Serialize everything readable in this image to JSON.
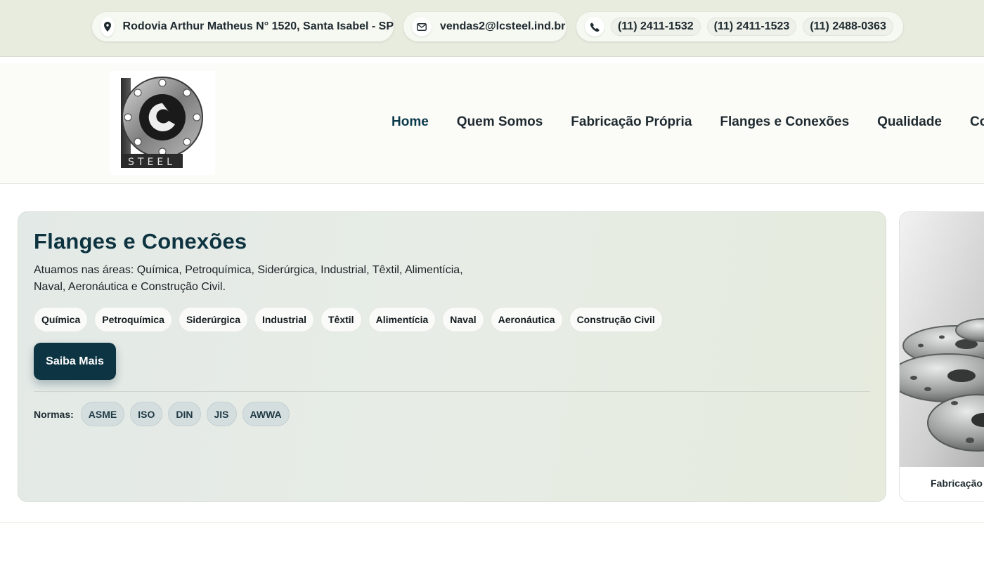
{
  "topbar": {
    "address": "Rodovia Arthur Matheus N° 1520, Santa Isabel - SP",
    "email": "vendas2@lcsteel.ind.br",
    "phones": [
      "(11) 2411-1532",
      "(11) 2411-1523",
      "(11) 2488-0363"
    ],
    "icons": {
      "address": "map-pin-icon",
      "email": "mail-icon",
      "phone": "phone-icon"
    }
  },
  "header": {
    "logo_text": "STEEL",
    "nav": [
      {
        "label": "Home",
        "active": true
      },
      {
        "label": "Quem Somos",
        "active": false
      },
      {
        "label": "Fabricação Própria",
        "active": false
      },
      {
        "label": "Flanges e Conexões",
        "active": false
      },
      {
        "label": "Qualidade",
        "active": false
      },
      {
        "label": "Contato",
        "active": false
      }
    ]
  },
  "hero": {
    "title": "Flanges e Conexões",
    "description": "Atuamos nas áreas: Química, Petroquímica, Siderúrgica, Industrial, Têxtil, Alimentícia, Naval, Aeronáutica e Construção Civil.",
    "tags": [
      "Química",
      "Petroquímica",
      "Siderúrgica",
      "Industrial",
      "Têxtil",
      "Alimentícia",
      "Naval",
      "Aeronáutica",
      "Construção Civil"
    ],
    "button_label": "Saiba Mais",
    "normas_label": "Normas:",
    "normas": [
      "ASME",
      "ISO",
      "DIN",
      "JIS",
      "AWWA"
    ]
  },
  "side_card": {
    "caption": "Fabricação e"
  },
  "colors": {
    "accent": "#0d3443",
    "topbar_bg": "#e7ecdf",
    "title": "#0d3340"
  }
}
